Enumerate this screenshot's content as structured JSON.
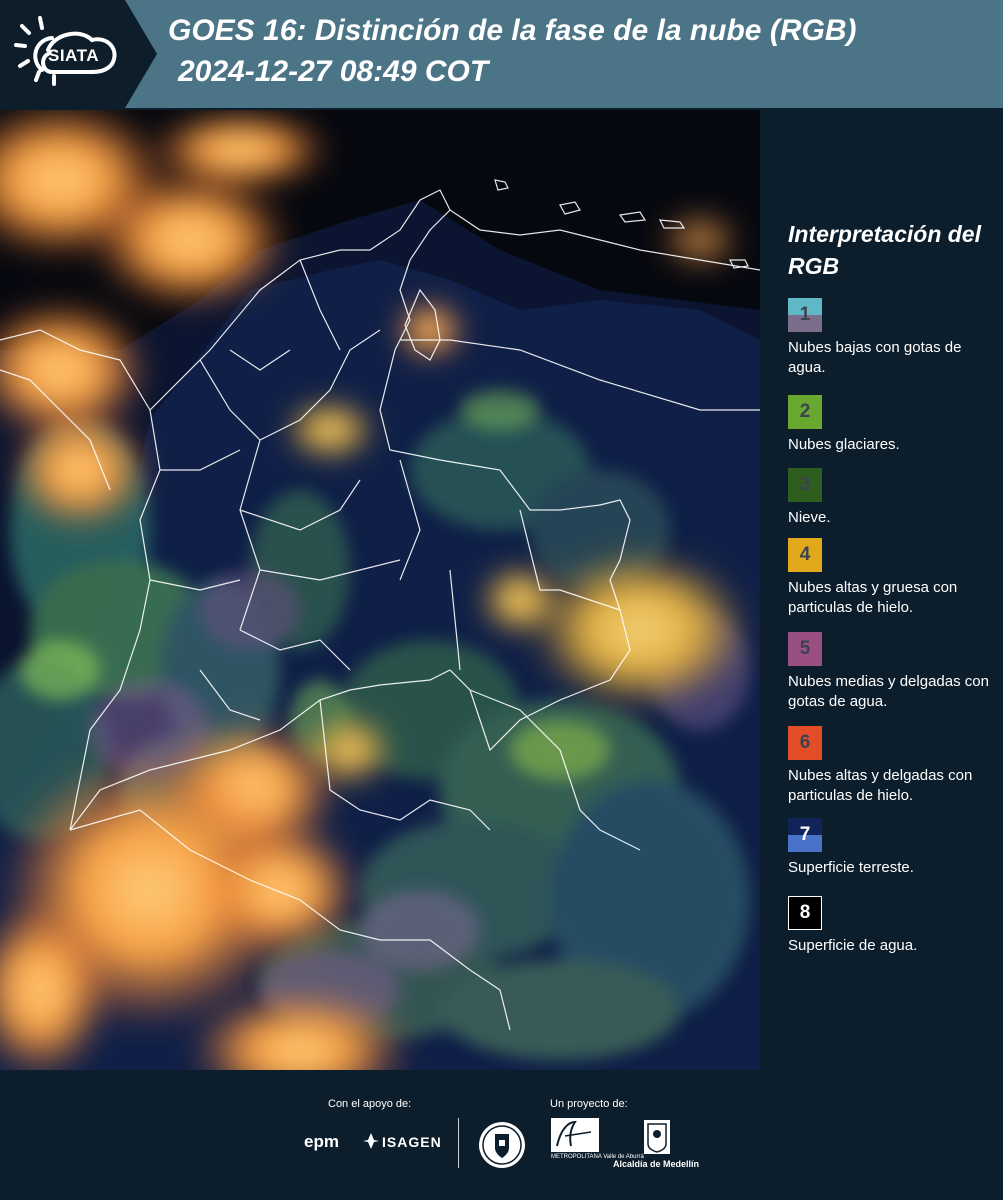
{
  "header": {
    "logo_text": "SIATA",
    "title": "GOES 16: Distinción de la fase de la nube (RGB)",
    "subtitle": "2024-12-27 08:49 COT",
    "background_color": "#4b7487",
    "logo_background_color": "#0e1d2a"
  },
  "legend": {
    "title": "Interpretación del RGB",
    "items": [
      {
        "number": "1",
        "label": "Nubes bajas con gotas de agua.",
        "color_top": "#5fb8c6",
        "color_bottom": "#7b6e8c"
      },
      {
        "number": "2",
        "label": "Nubes glaciares.",
        "color_top": "#68a82e",
        "color_bottom": "#68a82e"
      },
      {
        "number": "3",
        "label": "Nieve.",
        "color_top": "#2d5e1d",
        "color_bottom": "#2d5e1d"
      },
      {
        "number": "4",
        "label": "Nubes altas y gruesa con particulas de hielo.",
        "color_top": "#e2a81b",
        "color_bottom": "#e2a81b"
      },
      {
        "number": "5",
        "label": "Nubes medias y delgadas con gotas de agua.",
        "color_top": "#9a4f82",
        "color_bottom": "#9a4f82"
      },
      {
        "number": "6",
        "label": "Nubes altas y delgadas con particulas de hielo.",
        "color_top": "#e34d27",
        "color_bottom": "#e34d27"
      },
      {
        "number": "7",
        "label": "Superficie terreste.",
        "color_top": "#12235a",
        "color_bottom": "#4a72c8"
      },
      {
        "number": "8",
        "label": "Superficie de agua.",
        "color_top": "#000000",
        "color_bottom": "#000000"
      }
    ]
  },
  "footer": {
    "support_label": "Con el apoyo de:",
    "project_label": "Un proyecto de:",
    "sponsor_1": "epm",
    "sponsor_2": "ISAGEN",
    "partner_area": "Área",
    "partner_area_sub": "METROPOLITANA Valle de Aburrá",
    "partner_alcaldia": "Alcaldía de Medellín"
  }
}
